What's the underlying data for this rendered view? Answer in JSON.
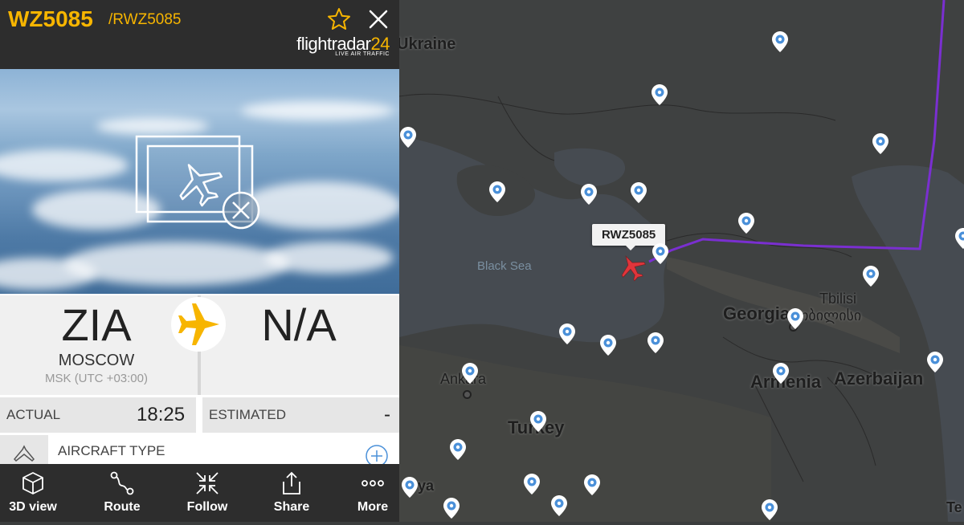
{
  "flight": {
    "number": "WZ5085",
    "callsign_sub": "/RWZ5085"
  },
  "brand": {
    "name_text": "flightradar",
    "name_num": "24",
    "tagline": "LIVE AIR TRAFFIC"
  },
  "route": {
    "origin_code": "ZIA",
    "origin_city": "MOSCOW",
    "origin_tz": "MSK (UTC +03:00)",
    "dest_code": "N/A"
  },
  "times": {
    "actual_label": "ACTUAL",
    "actual_value": "18:25",
    "estimated_label": "ESTIMATED",
    "estimated_value": "-"
  },
  "aircraft": {
    "type_label": "AIRCRAFT TYPE"
  },
  "toolbar": [
    {
      "label": "3D view",
      "icon": "cube-icon"
    },
    {
      "label": "Route",
      "icon": "route-icon"
    },
    {
      "label": "Follow",
      "icon": "follow-icon"
    },
    {
      "label": "Share",
      "icon": "share-icon"
    },
    {
      "label": "More",
      "icon": "more-icon"
    }
  ],
  "map": {
    "callsign_tag": "RWZ5085",
    "labels": {
      "ukraine": "Ukraine",
      "black_sea": "Black Sea",
      "georgia": "Georgia",
      "tbilisi": "Tbilisi",
      "tbilisi_local": "თბილისი",
      "armenia": "Armenia",
      "azerbaijan": "Azerbaijan",
      "ankara": "Ankara",
      "turkey": "Turkey",
      "partial_bottom": "ya",
      "partial_right": "Te"
    }
  },
  "colors": {
    "accent": "#f7b500",
    "header_bg": "#2d2d2d",
    "track": "#7a2fd0",
    "aircraft": "#e0353b",
    "pin": "#4a90d9"
  }
}
